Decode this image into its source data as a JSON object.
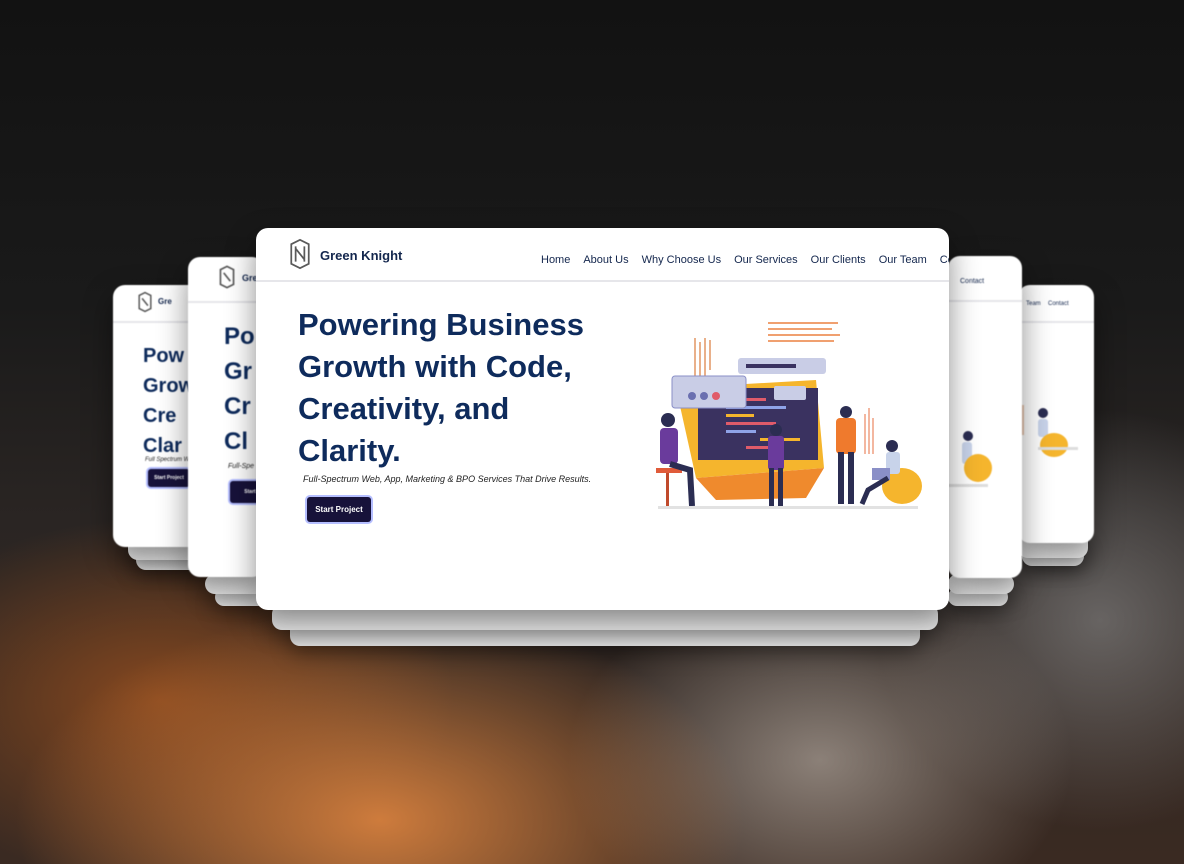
{
  "brand": {
    "name": "Green Knight",
    "short": "Gre",
    "shorter": "Gre"
  },
  "nav": {
    "items": [
      "Home",
      "About Us",
      "Why Choose Us",
      "Our Services",
      "Our Clients",
      "Our Team",
      "Contact"
    ],
    "right_card_1": "Contact",
    "right_card_2a": "Team",
    "right_card_2b": "Contact"
  },
  "hero": {
    "title_lines": [
      "Powering Business",
      "Growth with Code,",
      "Creativity, and",
      "Clarity."
    ],
    "partial_lines_left1": [
      "Po",
      "Gr",
      "Cr",
      "Cl"
    ],
    "partial_lines_left2": [
      "Pow",
      "Grow",
      "Cre",
      "Clar"
    ],
    "subtitle": "Full-Spectrum Web, App, Marketing & BPO Services That Drive Results.",
    "subtitle_partial_1": "Full-Spe",
    "subtitle_partial_2": "Full Spectrum W",
    "cta_label": "Start Project",
    "cta_partial": "Start"
  },
  "colors": {
    "title": "#0e2b5c",
    "cta_bg": "#17123a",
    "accent_yellow": "#f5b52d",
    "accent_orange": "#ef7a2d",
    "accent_purple": "#6a3b9c"
  },
  "icons": {
    "logo": "knight-logo-icon",
    "illustration": "team-coding-illustration"
  }
}
